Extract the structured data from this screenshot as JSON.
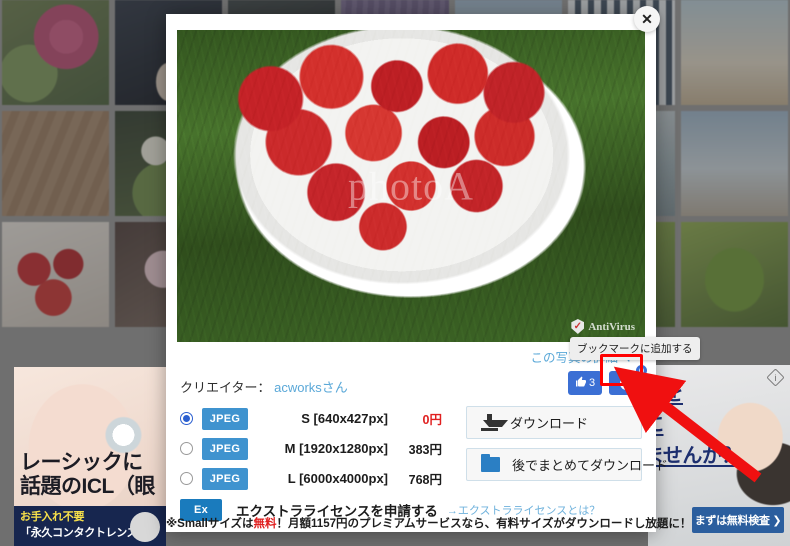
{
  "modal": {
    "close_label": "✕",
    "detail_link": "この写真の詳細ペー",
    "creator_label": "クリエイター：",
    "creator_name": "acworksさん",
    "watermark": "photoA",
    "antivirus_badge": "AntiVirus"
  },
  "social": {
    "like_glyph": "👍",
    "like_count": "3",
    "bookmark_glyph": "+",
    "bookmark_badge": "0",
    "tooltip": "ブックマークに追加する"
  },
  "options": [
    {
      "format": "JPEG",
      "size": "S [640x427px]",
      "price": "0円",
      "free": true,
      "selected": true
    },
    {
      "format": "JPEG",
      "size": "M [1920x1280px]",
      "price": "383円",
      "free": false,
      "selected": false
    },
    {
      "format": "JPEG",
      "size": "L [6000x4000px]",
      "price": "768円",
      "free": false,
      "selected": false
    }
  ],
  "extra_license": {
    "tag": "Ex",
    "label": "エクストラライセンスを申請する",
    "link": "→エクストラライセンスとは？"
  },
  "downloads": {
    "primary": "ダウンロード",
    "secondary": "後でまとめてダウンロード"
  },
  "notice": {
    "prefix": "※Smallサイズは",
    "highlight": "無料",
    "suffix": "！月額1157円のプレミアムサービスなら、有料サイズがダウンロードし放題に！"
  },
  "ads": {
    "left": {
      "headline_l1": "レーシックに",
      "headline_l2": "話題のICL（眼",
      "bar_l1": "お手入れ不要",
      "bar_l2": "「永久コンタクトレンズ」"
    },
    "right": {
      "line1": "間を",
      "line2": "に",
      "line3": "ませんか？",
      "button": "まずは無料検査 ❯",
      "small": "%)",
      "badge": "i"
    }
  },
  "colors": {
    "accent_blue": "#3f93cf",
    "link_blue": "#5aa8d8",
    "social_blue": "#3b6fd4",
    "free_red": "#e02020",
    "highlight_red": "#ff0000"
  }
}
